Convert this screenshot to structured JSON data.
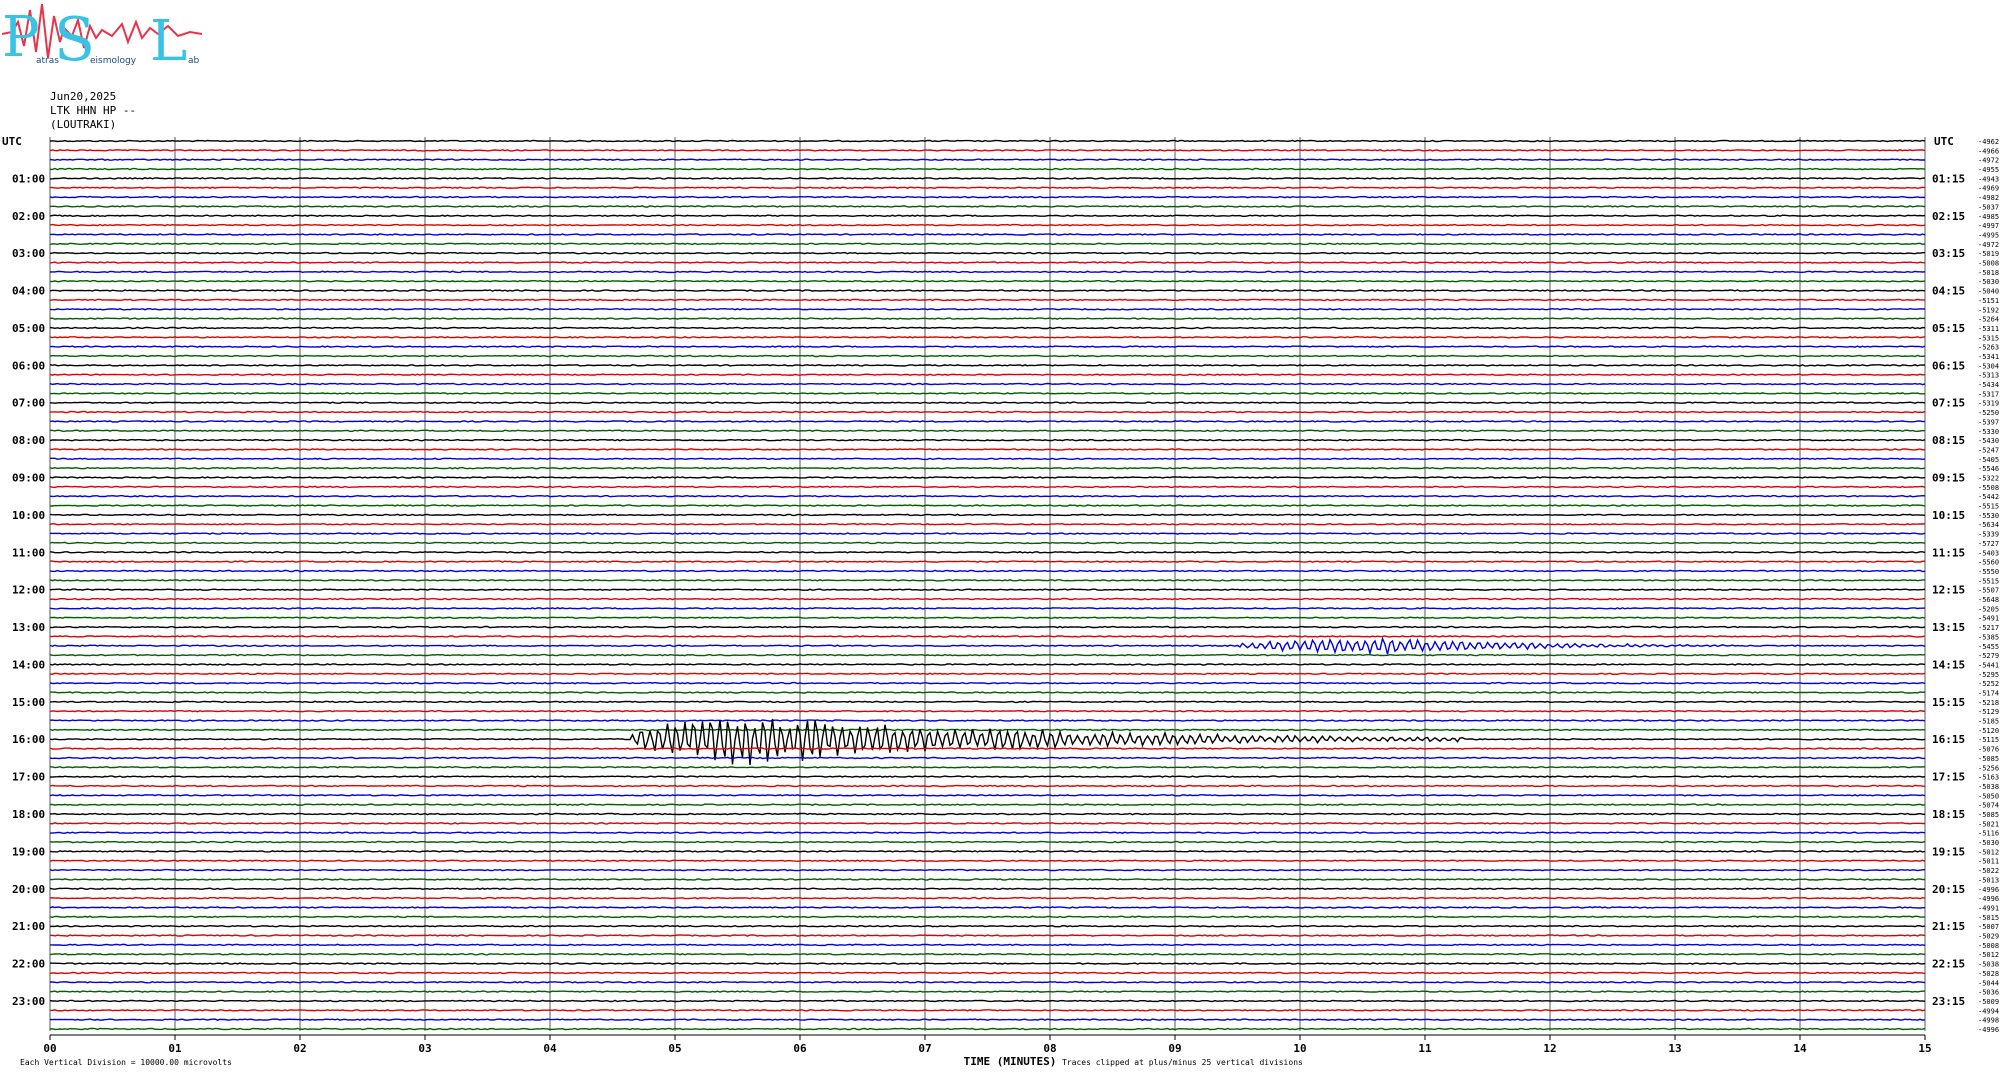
{
  "logo": {
    "letters": [
      "P",
      "S",
      "L"
    ],
    "words": [
      "atras",
      "eismology",
      "ab"
    ],
    "letter_color": "#38c3e4",
    "trace_color": "#e8344a"
  },
  "header": {
    "date": "Jun20,2025",
    "station": "LTK HHN HP --",
    "location": "(LOUTRAKI)"
  },
  "chart_data": {
    "type": "line",
    "title": "",
    "left_axis_label": "UTC",
    "right_axis_label": "UTC",
    "xlabel": "TIME (MINUTES)",
    "xlim": [
      0,
      15
    ],
    "x_ticks": [
      "00",
      "01",
      "02",
      "03",
      "04",
      "05",
      "06",
      "07",
      "08",
      "09",
      "10",
      "11",
      "12",
      "13",
      "14",
      "15"
    ],
    "rows_per_hour": 4,
    "row_minutes": 15,
    "trace_colors": [
      "#000000",
      "#e00000",
      "#0000e0",
      "#006000"
    ],
    "left_hour_labels": [
      "01:00",
      "02:00",
      "03:00",
      "04:00",
      "05:00",
      "06:00",
      "07:00",
      "08:00",
      "09:00",
      "10:00",
      "11:00",
      "12:00",
      "13:00",
      "14:00",
      "15:00",
      "16:00",
      "17:00",
      "18:00",
      "19:00",
      "20:00",
      "21:00",
      "22:00",
      "23:00"
    ],
    "right_hour_labels": [
      "01:15",
      "02:15",
      "03:15",
      "04:15",
      "05:15",
      "06:15",
      "07:15",
      "08:15",
      "09:15",
      "10:15",
      "11:15",
      "12:15",
      "13:15",
      "14:15",
      "15:15",
      "16:15",
      "17:15",
      "18:15",
      "19:15",
      "20:15",
      "21:15",
      "22:15",
      "23:15"
    ],
    "right_values": [
      "-4962",
      "-4966",
      "-4972",
      "-4955",
      "-4943",
      "-4969",
      "-4982",
      "-5037",
      "-4985",
      "-4997",
      "-4995",
      "-4972",
      "-5019",
      "-5008",
      "-5018",
      "-5030",
      "-5040",
      "-5151",
      "-5192",
      "-5264",
      "-5311",
      "-5315",
      "-5263",
      "-5341",
      "-5304",
      "-5313",
      "-5434",
      "-5317",
      "-5319",
      "-5250",
      "-5397",
      "-5330",
      "-5430",
      "-5247",
      "-5405",
      "-5546",
      "-5322",
      "-5508",
      "-5442",
      "-5515",
      "-5530",
      "-5634",
      "-5339",
      "-5727",
      "-5403",
      "-5560",
      "-5550",
      "-5515",
      "-5507",
      "-5648",
      "-5205",
      "-5491",
      "-5217",
      "-5385",
      "-5455",
      "-5279",
      "-5441",
      "-5295",
      "-5252",
      "-5174",
      "-5218",
      "-5129",
      "-5185",
      "-5120",
      "-5115",
      "-5076",
      "-5085",
      "-5256",
      "-5163",
      "-5038",
      "-5050",
      "-5074",
      "-5085",
      "-5021",
      "-5116",
      "-5030",
      "-5012",
      "-5011",
      "-5022",
      "-5013",
      "-4996",
      "-4996",
      "-4991",
      "-5015",
      "-5007",
      "-5029",
      "-5008",
      "-5012",
      "-5038",
      "-5028",
      "-5044",
      "-5036",
      "-5009",
      "-4994",
      "-4998",
      "-4996"
    ],
    "events": [
      {
        "row": 54,
        "start_min": 9.5,
        "peak_min": 10.7,
        "end_min": 13.5,
        "amplitude": 8
      },
      {
        "row": 64,
        "start_min": 4.65,
        "peak_min": 5.5,
        "end_min": 11.3,
        "amplitude": 24
      }
    ],
    "footer_left": "Each Vertical Division = 10000.00 microvolts",
    "footer_right": "Traces clipped at plus/minus 25 vertical divisions"
  }
}
